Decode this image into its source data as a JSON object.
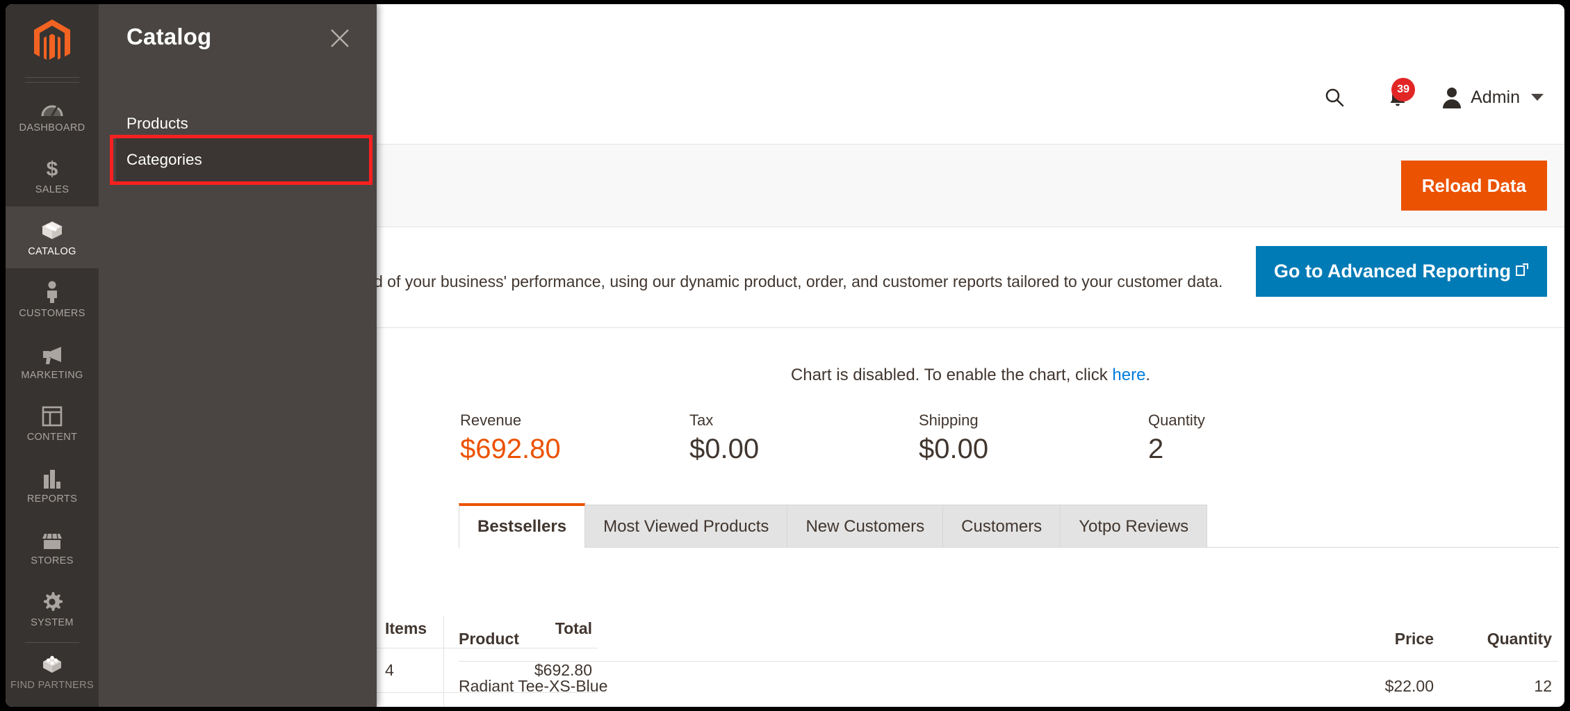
{
  "rail": {
    "logo_name": "magento-logo",
    "items": [
      {
        "label": "DASHBOARD",
        "icon": "dashboard-gauge-icon",
        "active": false
      },
      {
        "label": "SALES",
        "icon": "dollar-sign-icon",
        "active": false
      },
      {
        "label": "CATALOG",
        "icon": "box-icon",
        "active": true
      },
      {
        "label": "CUSTOMERS",
        "icon": "person-icon",
        "active": false
      },
      {
        "label": "MARKETING",
        "icon": "megaphone-icon",
        "active": false
      },
      {
        "label": "CONTENT",
        "icon": "layout-page-icon",
        "active": false
      },
      {
        "label": "REPORTS",
        "icon": "bar-chart-icon",
        "active": false
      },
      {
        "label": "STORES",
        "icon": "storefront-icon",
        "active": false
      },
      {
        "label": "SYSTEM",
        "icon": "gear-icon",
        "active": false
      },
      {
        "label": "FIND PARTNERS",
        "icon": "extension-blocks-icon",
        "active": false
      }
    ]
  },
  "flyout": {
    "title": "Catalog",
    "close_icon": "close-x-icon",
    "items": [
      {
        "label": "Products",
        "selected": false
      },
      {
        "label": "Categories",
        "selected": true
      }
    ]
  },
  "header": {
    "search_icon": "search-icon",
    "notifications_icon": "bell-icon",
    "notifications_count": "39",
    "avatar_icon": "user-avatar-icon",
    "account_name": "Admin",
    "caret_icon": "chevron-down-icon"
  },
  "page_actions": {
    "reload_label": "Reload Data"
  },
  "advanced_reporting": {
    "description": "d of your business' performance, using our dynamic product, order, and customer reports tailored to your customer data.",
    "button_label": "Go to Advanced Reporting",
    "button_icon": "external-link-icon"
  },
  "chart_notice": {
    "text_before": "Chart is disabled. To enable the chart, click ",
    "link_label": "here",
    "text_after": "."
  },
  "totals": [
    {
      "label": "Revenue",
      "value": "$692.80",
      "accent": true
    },
    {
      "label": "Tax",
      "value": "$0.00",
      "accent": false
    },
    {
      "label": "Shipping",
      "value": "$0.00",
      "accent": false
    },
    {
      "label": "Quantity",
      "value": "2",
      "accent": false
    }
  ],
  "tabs": [
    {
      "label": "Bestsellers",
      "active": true
    },
    {
      "label": "Most Viewed Products",
      "active": false
    },
    {
      "label": "New Customers",
      "active": false
    },
    {
      "label": "Customers",
      "active": false
    },
    {
      "label": "Yotpo Reviews",
      "active": false
    }
  ],
  "last_orders": {
    "columns": {
      "items": "Items",
      "total": "Total"
    },
    "rows": [
      {
        "items": "4",
        "total": "$692.80"
      }
    ]
  },
  "bestsellers": {
    "columns": {
      "product": "Product",
      "price": "Price",
      "quantity": "Quantity"
    },
    "rows": [
      {
        "product": "Radiant Tee-XS-Blue",
        "price": "$22.00",
        "quantity": "12"
      }
    ]
  },
  "colors": {
    "magento_orange": "#eb5202",
    "link_blue": "#007bdb",
    "button_blue": "#007bb6",
    "rail_bg": "#373330",
    "flyout_bg": "#4a4542",
    "annotation_red": "#fb2020",
    "badge_red": "#e22626"
  }
}
